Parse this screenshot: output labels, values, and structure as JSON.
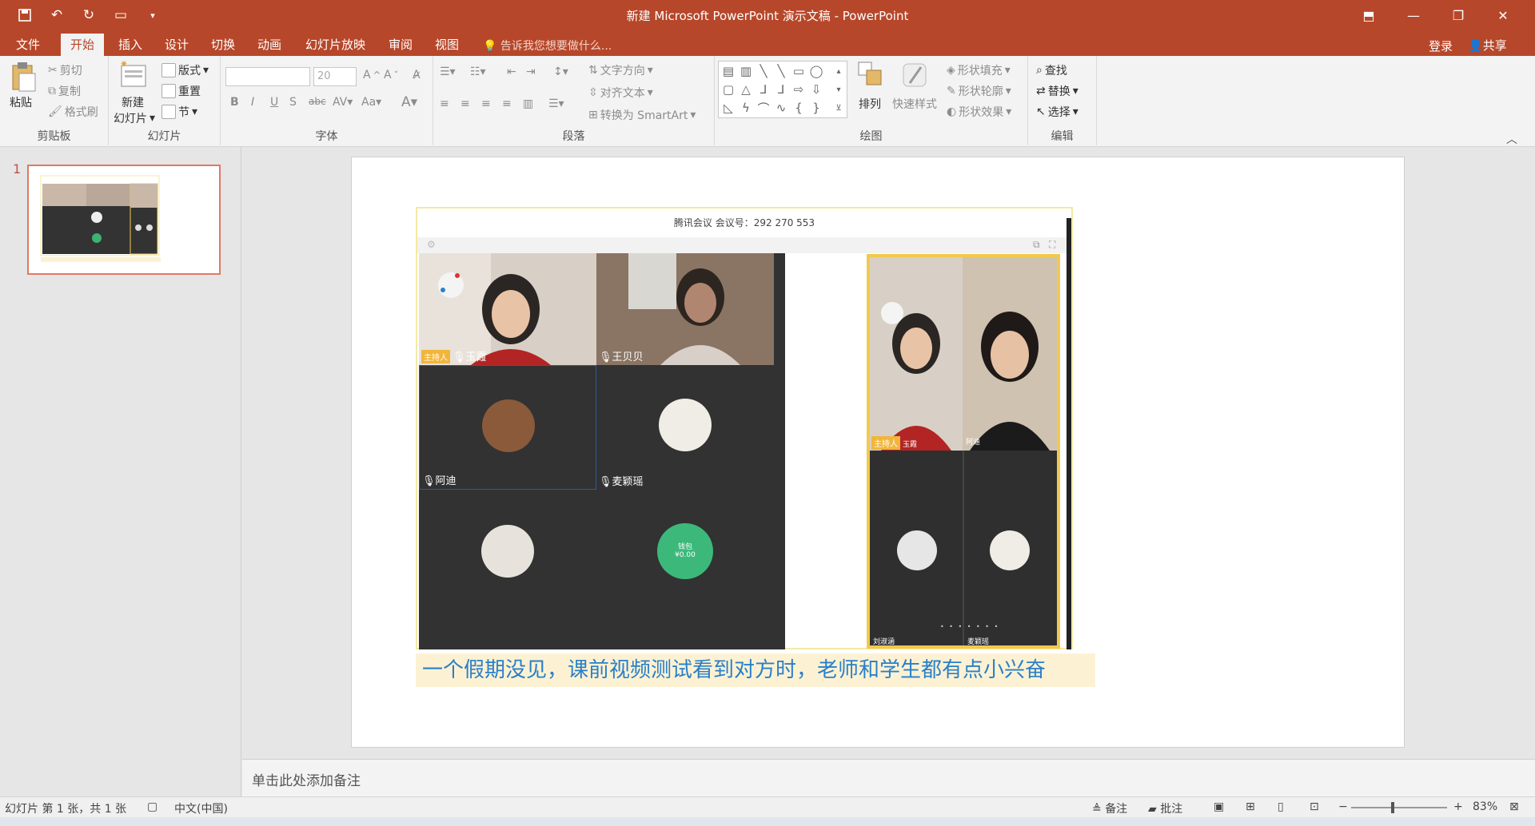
{
  "window": {
    "title": "新建 Microsoft PowerPoint 演示文稿 - PowerPoint"
  },
  "tabs": [
    {
      "label": "文件"
    },
    {
      "label": "开始"
    },
    {
      "label": "插入"
    },
    {
      "label": "设计"
    },
    {
      "label": "切换"
    },
    {
      "label": "动画"
    },
    {
      "label": "幻灯片放映"
    },
    {
      "label": "审阅"
    },
    {
      "label": "视图"
    }
  ],
  "tellme": "告诉我您想要做什么...",
  "account": {
    "login": "登录",
    "share": "共享"
  },
  "ribbon": {
    "clipboard": {
      "label": "剪贴板",
      "paste": "粘贴",
      "cut": "剪切",
      "copy": "复制",
      "format_painter": "格式刷"
    },
    "slides": {
      "label": "幻灯片",
      "new_slide": "新建",
      "new_slide2": "幻灯片",
      "layout": "版式",
      "reset": "重置",
      "section": "节"
    },
    "font": {
      "label": "字体",
      "size": "20"
    },
    "paragraph": {
      "label": "段落",
      "text_direction": "文字方向",
      "align_text": "对齐文本",
      "smartart": "转换为 SmartArt"
    },
    "drawing": {
      "label": "绘图",
      "arrange": "排列",
      "quick_styles": "快速样式",
      "shape_fill": "形状填充",
      "shape_outline": "形状轮廓",
      "shape_effects": "形状效果"
    },
    "editing": {
      "label": "编辑",
      "find": "查找",
      "replace": "替换",
      "select": "选择"
    }
  },
  "thumbnail": {
    "number": "1"
  },
  "slide": {
    "meeting_header": "腾讯会议 会议号：292 270 553",
    "host_tag": "主持人",
    "participants": [
      "玉霞",
      "王贝贝",
      "阿迪",
      "麦颖瑶"
    ],
    "side_panel": {
      "names": [
        "玉霞",
        "阿迪",
        "刘淑涵",
        "麦颖瑶"
      ]
    },
    "green_tile_text": [
      "钱包",
      "¥0.00"
    ],
    "caption": "一个假期没见，课前视频测试看到对方时，老师和学生都有点小兴奋"
  },
  "notes_placeholder": "单击此处添加备注",
  "status": {
    "slide_info": "幻灯片 第 1 张，共 1 张",
    "language": "中文(中国)",
    "notes": "备注",
    "comments": "批注",
    "zoom": "83%"
  },
  "colors": {
    "accent": "#b7472a",
    "caption_text": "#2a7fc9",
    "highlight": "#f2c94c"
  }
}
